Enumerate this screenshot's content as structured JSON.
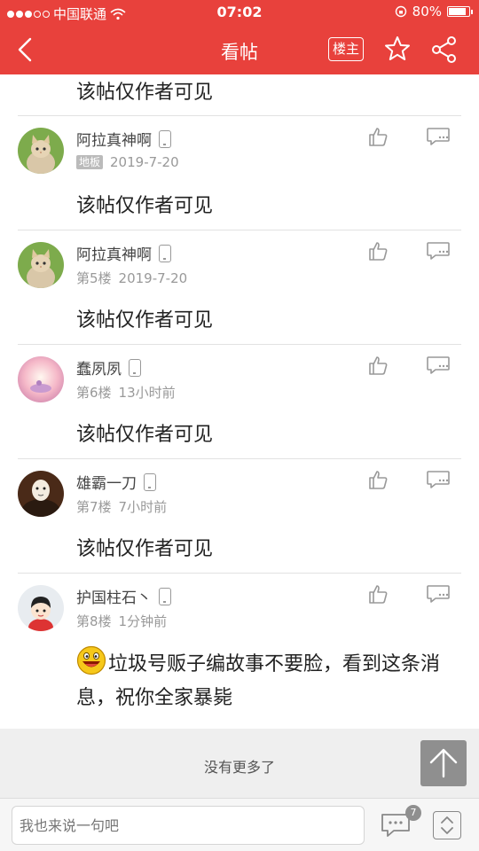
{
  "status_bar": {
    "carrier": "中国联通",
    "time": "07:02",
    "battery": "80%"
  },
  "nav": {
    "title": "看帖",
    "op_button": "楼主"
  },
  "first_post_text": "该帖仅作者可见",
  "posts": [
    {
      "username": "阿拉真神啊",
      "floor": "地板",
      "time": "2019-7-20",
      "text": "该帖仅作者可见"
    },
    {
      "username": "阿拉真神啊",
      "floor": "第5楼",
      "time": "2019-7-20",
      "text": "该帖仅作者可见"
    },
    {
      "username": "蠢夙夙",
      "floor": "第6楼",
      "time": "13小时前",
      "text": "该帖仅作者可见"
    },
    {
      "username": "雄霸一刀",
      "floor": "第7楼",
      "time": "7小时前",
      "text": "该帖仅作者可见"
    },
    {
      "username": "护国柱石丶",
      "floor": "第8楼",
      "time": "1分钟前",
      "text": "垃圾号贩子编故事不要脸，看到这条消息，祝你全家暴毙"
    }
  ],
  "footer": {
    "no_more": "没有更多了"
  },
  "bottom_bar": {
    "input_placeholder": "我也来说一句吧",
    "comment_count": "7"
  },
  "colors": {
    "accent": "#e8413c"
  }
}
